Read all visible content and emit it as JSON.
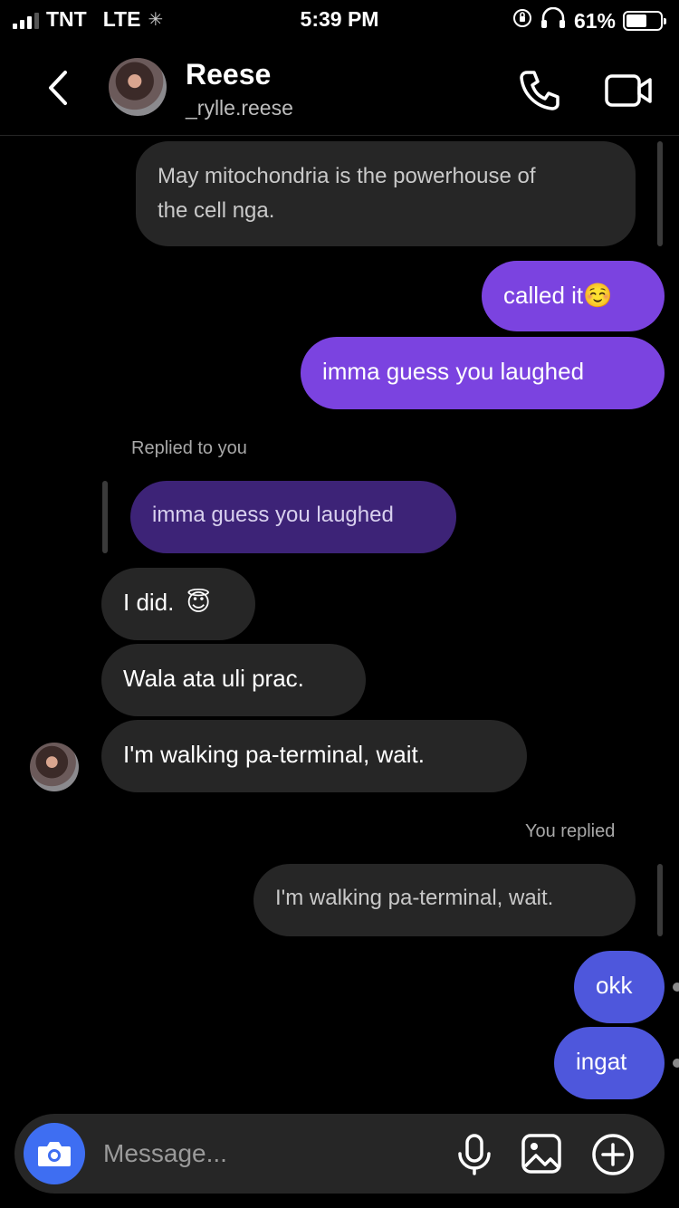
{
  "status_bar": {
    "carrier": "TNT",
    "network": "LTE",
    "time": "5:39 PM",
    "battery": "61%",
    "battery_level": 0.61
  },
  "header": {
    "name": "Reese",
    "handle": "_rylle.reese"
  },
  "messages": {
    "m1": "May mitochondria is the powerhouse of",
    "m1b": "the cell nga.",
    "m2": "called it",
    "m2_emoji": "☺️",
    "m3": "imma guess you laughed",
    "reply_label": "Replied to you",
    "reply_quote": "imma guess you laughed",
    "m4": "I did.",
    "m4_emoji": "😇",
    "m5": "Wala ata uli prac.",
    "m6": "I'm walking pa-terminal, wait.",
    "you_replied_label": "You replied",
    "you_replied_quote": "I'm walking pa-terminal, wait.",
    "m7": "okk",
    "m8": "ingat"
  },
  "composer": {
    "placeholder": "Message..."
  },
  "icons": {
    "back": "chevron-left-icon",
    "call": "phone-icon",
    "video": "video-camera-icon",
    "camera": "camera-icon",
    "mic": "microphone-icon",
    "gallery": "image-icon",
    "plus": "plus-circle-icon"
  }
}
